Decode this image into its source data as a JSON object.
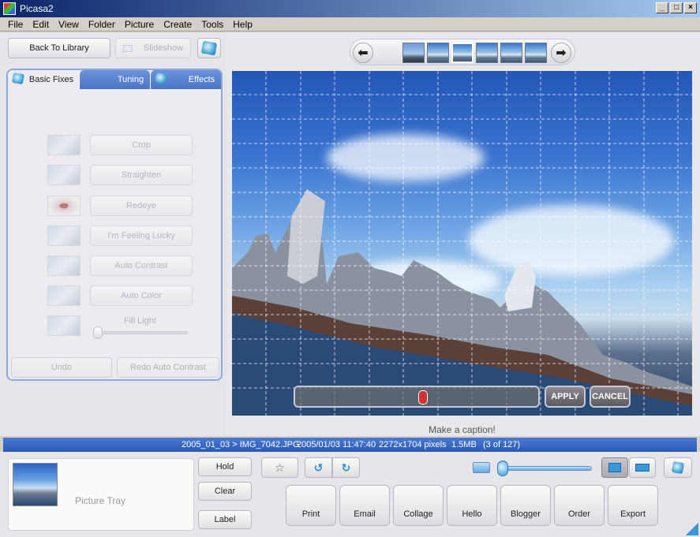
{
  "window": {
    "title": "Picasa2"
  },
  "menu": [
    "File",
    "Edit",
    "View",
    "Folder",
    "Picture",
    "Create",
    "Tools",
    "Help"
  ],
  "left": {
    "back_label": "Back To Library",
    "slideshow_label": "Slideshow",
    "tabs": [
      "Basic Fixes",
      "Tuning",
      "Effects"
    ],
    "fixes": [
      "Crop",
      "Straighten",
      "Redeye",
      "I'm Feeling Lucky",
      "Auto Contrast",
      "Auto Color"
    ],
    "fill_light_label": "Fill Light",
    "fill_light_value": 0,
    "undo_label": "Undo",
    "redo_label": "Redo Auto Contrast"
  },
  "crop": {
    "apply_label": "APPLY",
    "cancel_label": "CANCEL"
  },
  "caption_placeholder": "Make a caption!",
  "status": {
    "path": "2005_01_03 > IMG_7042.JPG",
    "datetime": "2005/01/03 11:47:40",
    "dimensions": "2272x1704 pixels",
    "size": "1.5MB",
    "index": "(3 of 127)"
  },
  "tray": {
    "label": "Picture Tray",
    "hold_label": "Hold",
    "clear_label": "Clear",
    "label_label": "Label"
  },
  "actions": [
    "Print",
    "Email",
    "Collage",
    "Hello",
    "Blogger",
    "Order",
    "Export"
  ],
  "colors": {
    "accent": "#3a6ad0",
    "tab_blue": "#5a80d0",
    "status_bar": "#3a68c4"
  }
}
